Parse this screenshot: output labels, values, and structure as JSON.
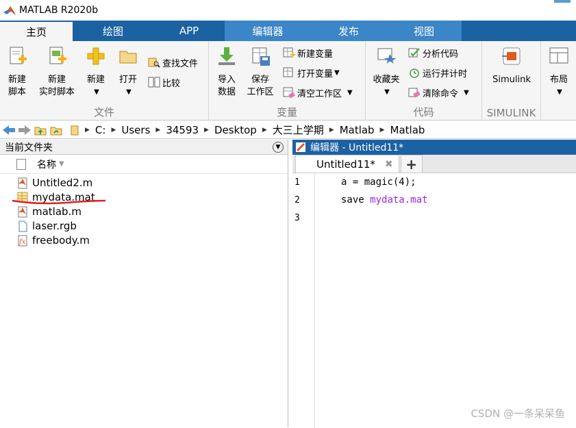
{
  "window": {
    "title": "MATLAB R2020b"
  },
  "tabs": [
    "主页",
    "绘图",
    "APP",
    "编辑器",
    "发布",
    "视图"
  ],
  "ribbon": {
    "file_group": {
      "label": "文件",
      "new_script": "新建\n脚本",
      "new_live_script": "新建\n实时脚本",
      "new": "新建",
      "open": "打开",
      "find_files": "查找文件",
      "compare": "比较"
    },
    "variable_group": {
      "label": "变量",
      "import_data": "导入\n数据",
      "save_workspace": "保存\n工作区",
      "new_variable": "新建变量",
      "open_variable": "打开变量",
      "clear_workspace": "清空工作区"
    },
    "code_group": {
      "label": "代码",
      "favorites": "收藏夹",
      "analyze_code": "分析代码",
      "run_and_time": "运行并计时",
      "clear_commands": "清除命令"
    },
    "simulink_group": {
      "label": "SIMULINK",
      "simulink": "Simulink"
    },
    "layout": "布局"
  },
  "address": {
    "path": [
      "C:",
      "Users",
      "34593",
      "Desktop",
      "大三上学期",
      "Matlab",
      "Matlab"
    ]
  },
  "file_browser": {
    "title": "当前文件夹",
    "column_name": "名称",
    "files": [
      {
        "name": "Untitled2.m",
        "icon": "matlab-script-icon"
      },
      {
        "name": "mydata.mat",
        "icon": "mat-file-icon"
      },
      {
        "name": "matlab.m",
        "icon": "matlab-script-icon"
      },
      {
        "name": "laser.rgb",
        "icon": "document-icon"
      },
      {
        "name": "freebody.m",
        "icon": "matlab-function-icon"
      }
    ]
  },
  "editor": {
    "header": "编辑器 - Untitled11*",
    "tab_label": "Untitled11*",
    "lines": [
      {
        "num": "1",
        "code": "a = magic(4);",
        "str": ""
      },
      {
        "num": "2",
        "code": "save ",
        "str": "mydata.mat"
      },
      {
        "num": "3",
        "code": "",
        "str": ""
      }
    ]
  },
  "watermark": "CSDN @一条呆呆鱼",
  "colors": {
    "tab_bar": "#1b62a3",
    "editor_tab_group": "#3a86c8",
    "string": "#a020f0",
    "annotation": "#e02020"
  }
}
